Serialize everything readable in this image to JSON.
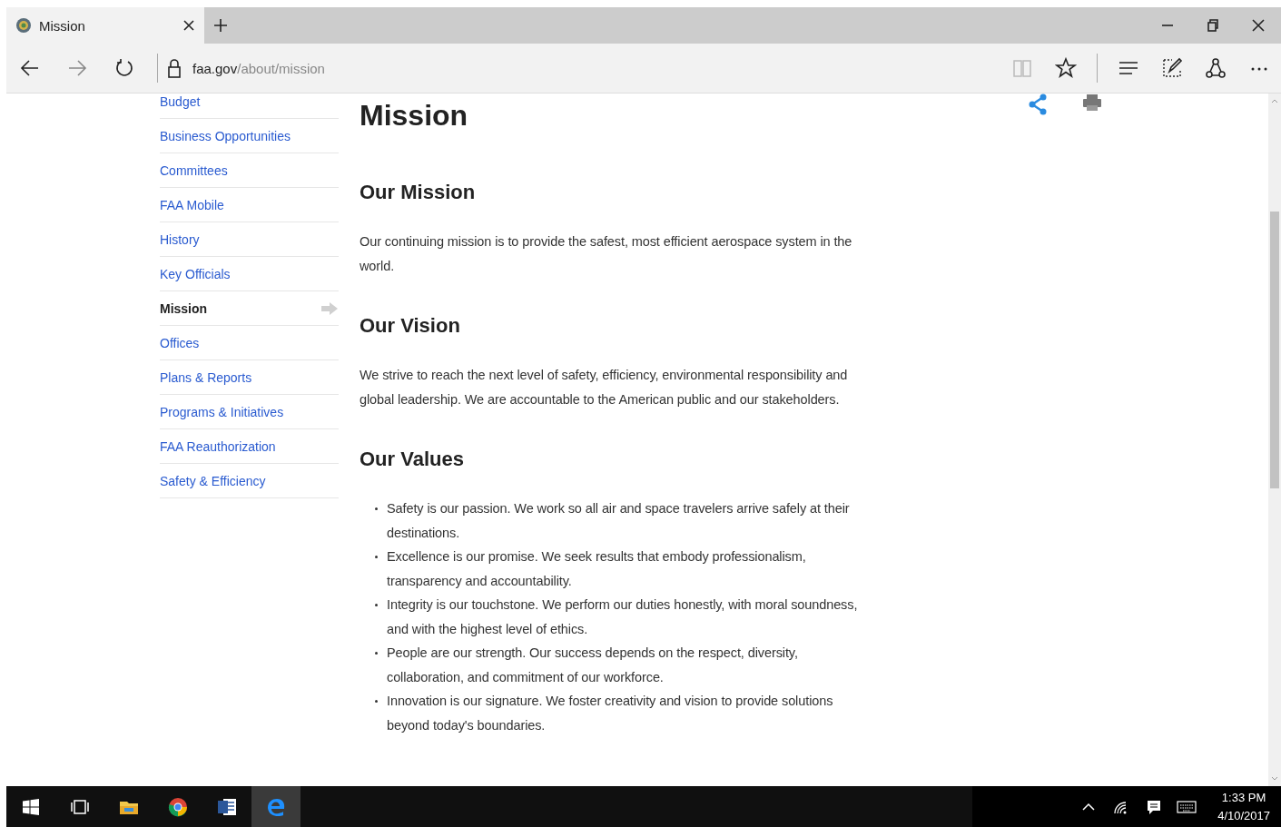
{
  "tabs": [
    {
      "title": "Mission",
      "selected": true
    }
  ],
  "address_bar": {
    "domain": "faa.gov",
    "path": "/about/mission"
  },
  "sidebar": {
    "items": [
      {
        "label": "Budget",
        "selected": false
      },
      {
        "label": "Business Opportunities",
        "selected": false
      },
      {
        "label": "Committees",
        "selected": false
      },
      {
        "label": "FAA Mobile",
        "selected": false
      },
      {
        "label": "History",
        "selected": false
      },
      {
        "label": "Key Officials",
        "selected": false
      },
      {
        "label": "Mission",
        "selected": true
      },
      {
        "label": "Offices",
        "selected": false
      },
      {
        "label": "Plans & Reports",
        "selected": false
      },
      {
        "label": "Programs & Initiatives",
        "selected": false
      },
      {
        "label": "FAA Reauthorization",
        "selected": false
      },
      {
        "label": "Safety & Efficiency",
        "selected": false
      }
    ]
  },
  "page": {
    "title": "Mission",
    "sections": [
      {
        "heading": "Our Mission",
        "kind": "paragraph",
        "text": "Our continuing mission is to provide the safest, most efficient aerospace system in the world."
      },
      {
        "heading": "Our Vision",
        "kind": "paragraph",
        "text": "We strive to reach the next level of safety, efficiency, environmental responsibility and global leadership. We are accountable to the American public and our stakeholders."
      },
      {
        "heading": "Our Values",
        "kind": "list",
        "items": [
          "Safety is our passion. We work so all air and space travelers arrive safely at their destinations.",
          "Excellence is our promise. We seek results that embody professionalism, transparency and accountability.",
          "Integrity is our touchstone. We perform our duties honestly, with moral soundness, and with the highest level of ethics.",
          "People are our strength. Our success depends on the respect, diversity, collaboration, and commitment of our workforce.",
          "Innovation is our signature. We foster creativity and vision to provide solutions beyond today's boundaries."
        ]
      }
    ]
  },
  "taskbar": {
    "apps": [
      {
        "kind": "task-view",
        "selected": false
      },
      {
        "kind": "files",
        "selected": false
      },
      {
        "kind": "chrome",
        "selected": false
      },
      {
        "kind": "word",
        "selected": false
      },
      {
        "kind": "edge",
        "selected": true
      }
    ],
    "time": "1:33 PM",
    "date": "4/10/2017"
  }
}
